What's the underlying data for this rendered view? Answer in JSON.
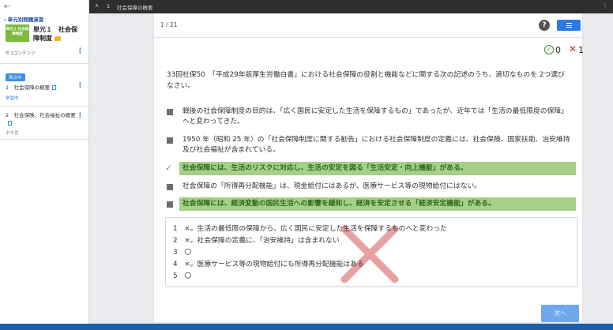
{
  "sidebar": {
    "back_label": "単元別問題演習",
    "thumb_text": "単元１ 社会保障制度",
    "unit_title": "単元１　社会保障制度",
    "content_count": "2コンテンツ",
    "current_badge": "表示中",
    "items": [
      {
        "title": "1　社会保障の概要",
        "status": "学習中"
      },
      {
        "title": "2　社会保険、社会福祉の概要",
        "status": "未学習"
      }
    ]
  },
  "topbar": {
    "number": "1",
    "title": "社会保障の概要"
  },
  "quiz": {
    "counter": "1 / 21",
    "help_label": "?",
    "correct_count": "0",
    "wrong_count": "1",
    "question": "33回社保50　「平成29年版厚生労働白書」における社会保障の役割と機能などに関する次の記述のうち、適切なものを 2つ選びなさい。",
    "choices": [
      {
        "text": "戦後の社会保障制度の目的は、「広く国民に安定した生活を保障するもの」であったが、近年では「生活の最低限度の保障」へと変わってきた。",
        "selected": false
      },
      {
        "text": "1950 年（昭和 25 年）の「社会保障制度に関する勧告」における社会保障制度の定義には、社会保険、国家扶助、治安維持及び社会福祉が含まれている。",
        "selected": false
      },
      {
        "text": "社会保障には、生活のリスクに対応し、生活の安定を図る「生活安定・向上機能」がある。",
        "selected": true
      },
      {
        "text": "社会保障の「所得再分配機能」は、現金給付にはあるが、医療サービス等の現物給付にはない。",
        "selected": false
      },
      {
        "text": "社会保障には、経済変動の国民生活への影響を緩和し、経済を安定させる「経済安定機能」がある。",
        "selected": true
      }
    ],
    "explanations": [
      "1　×。生活の最低限の保障から、広く国民に安定した生活を保障するものへと変わった",
      "2　×。社会保障の定義に、「治安維持」は含まれない",
      "3　〇",
      "4　×。医療サービス等の現物給付にも所得再分配機能はある",
      "5　〇"
    ],
    "next_label": "次へ"
  },
  "colors": {
    "accent": "#2a7be4",
    "highlight": "#a6cf8a",
    "correct": "#2e9a3a",
    "wrong": "#d42b2b",
    "topbar": "#2e2e2e"
  }
}
